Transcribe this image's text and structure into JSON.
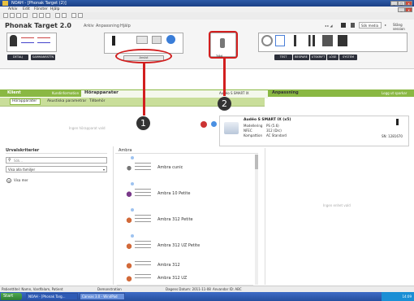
{
  "window": {
    "title": "NOAH - [Phonak Target (2)]",
    "controls": [
      "_",
      "□",
      "x"
    ],
    "app_controls": [
      "_",
      "□",
      "x"
    ]
  },
  "menubar": [
    "Arkiv",
    "Edit",
    "Fönster",
    "Hjälp"
  ],
  "app": {
    "title": "Phonak Target 2.0",
    "nav": [
      "Arkiv",
      "Anpassning",
      "Hjälp"
    ],
    "button_labels_left": [
      "DETALJ",
      "SAMMANFATTN"
    ],
    "button_labels_right": [
      "TEST",
      "BESPARE",
      "UTSKRIFT",
      "LÖSE",
      "SYSTEM"
    ],
    "annotated_button_1": "Anslut",
    "annotated_button_2": "Trådl",
    "search_placeholder": "Sök media",
    "right_action": "Stäng session"
  },
  "tabs": {
    "klient": "Klient",
    "klient_sub": "Kundinformation",
    "horapparater": "Hörapparater",
    "audeo_label": "Audéo S SMART IX",
    "anpassning": "Anpassning",
    "logout": "Logg ut sparkar"
  },
  "subtabs": [
    "Hörapparater",
    "Akustiska parametrar",
    "Tillbehör"
  ],
  "left_panel": {
    "hint": "Ingen hörapparat vald",
    "filter_title": "Urvalskriterier",
    "search_placeholder": "Sök...",
    "dropdown": "Visa alla familjer",
    "show_more": "Visa mer"
  },
  "device_card": {
    "name": "Audéo S SMART IX (x5)",
    "rows": [
      {
        "label": "Modellering",
        "value": "PS (5.6)"
      },
      {
        "label": "NFEC",
        "value": "312 (Drc)"
      },
      {
        "label": "Kompattion",
        "value": "AC Standard"
      }
    ],
    "serial": "SN: 1281670"
  },
  "list": {
    "header": "Ambra",
    "items": [
      "Ambra cunic",
      "Ambra 10 Petite",
      "Ambra 312 Petite",
      "Ambra 312 UZ Petite",
      "Ambra 312",
      "Ambra 312 UZ"
    ]
  },
  "right_hint": "Ingen enhet vald",
  "markers": [
    "1",
    "2"
  ],
  "statusbar": {
    "left": "Patienttitel: Namn, Vardfalam, Patient",
    "mid": "Demonstration",
    "date_label": "Dagens Datum: 2011-11-08",
    "user": "Anvandar ID: ABC"
  },
  "taskbar": {
    "start": "Start",
    "items": [
      "NOAH - [Phonak Targ...",
      "Canvas 3.0 - WindPad"
    ],
    "clock": "14:09"
  },
  "colors": {
    "green": "#8ab843",
    "green_light": "#c9de9a",
    "marker_red": "#d21f1f",
    "titlebar": "#1b3f86"
  }
}
